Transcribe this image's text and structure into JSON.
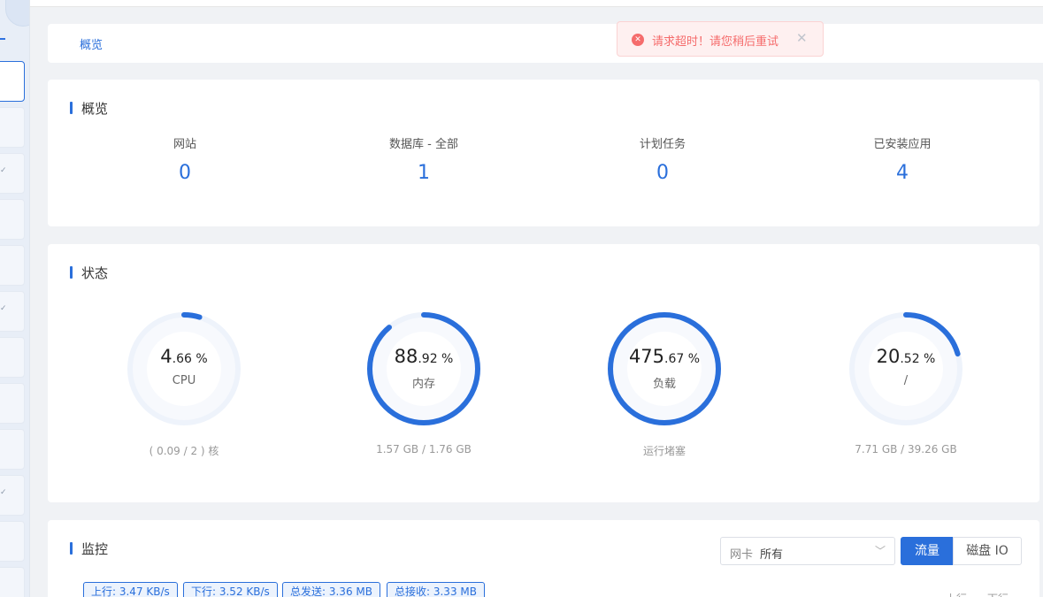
{
  "breadcrumb": {
    "current": "概览"
  },
  "toast": {
    "icon": "error-circle-icon",
    "message": "请求超时！请您稍后重试",
    "close_symbol": "✕",
    "color": "#f56c6c"
  },
  "overview": {
    "title": "概览",
    "items": [
      {
        "label": "网站",
        "value": "0"
      },
      {
        "label": "数据库 - 全部",
        "value": "1"
      },
      {
        "label": "计划任务",
        "value": "0"
      },
      {
        "label": "已安装应用",
        "value": "4"
      }
    ]
  },
  "status": {
    "title": "状态",
    "gauges": [
      {
        "int": "4",
        "dec": ".66 %",
        "name": "CPU",
        "sub": "( 0.09 / 2 ) 核",
        "percent": 4.66
      },
      {
        "int": "88",
        "dec": ".92 %",
        "name": "内存",
        "sub": "1.57 GB / 1.76 GB",
        "percent": 88.92
      },
      {
        "int": "475",
        "dec": ".67 %",
        "name": "负载",
        "sub": "运行堵塞",
        "percent": 100
      },
      {
        "int": "20",
        "dec": ".52 %",
        "name": "/",
        "sub": "7.71 GB / 39.26 GB",
        "percent": 20.52
      }
    ]
  },
  "monitor": {
    "title": "监控",
    "nic_prefix": "网卡",
    "nic_value": "所有",
    "btn_traffic": "流量",
    "btn_disk": "磁盘 IO",
    "tags": [
      "上行: 3.47 KB/s",
      "下行: 3.52 KB/s",
      "总发送: 3.36 MB",
      "总接收: 3.33 MB"
    ],
    "legend_up": "上行",
    "legend_down": "下行"
  },
  "colors": {
    "accent": "#2a6fdb",
    "track": "#eef3fb"
  }
}
